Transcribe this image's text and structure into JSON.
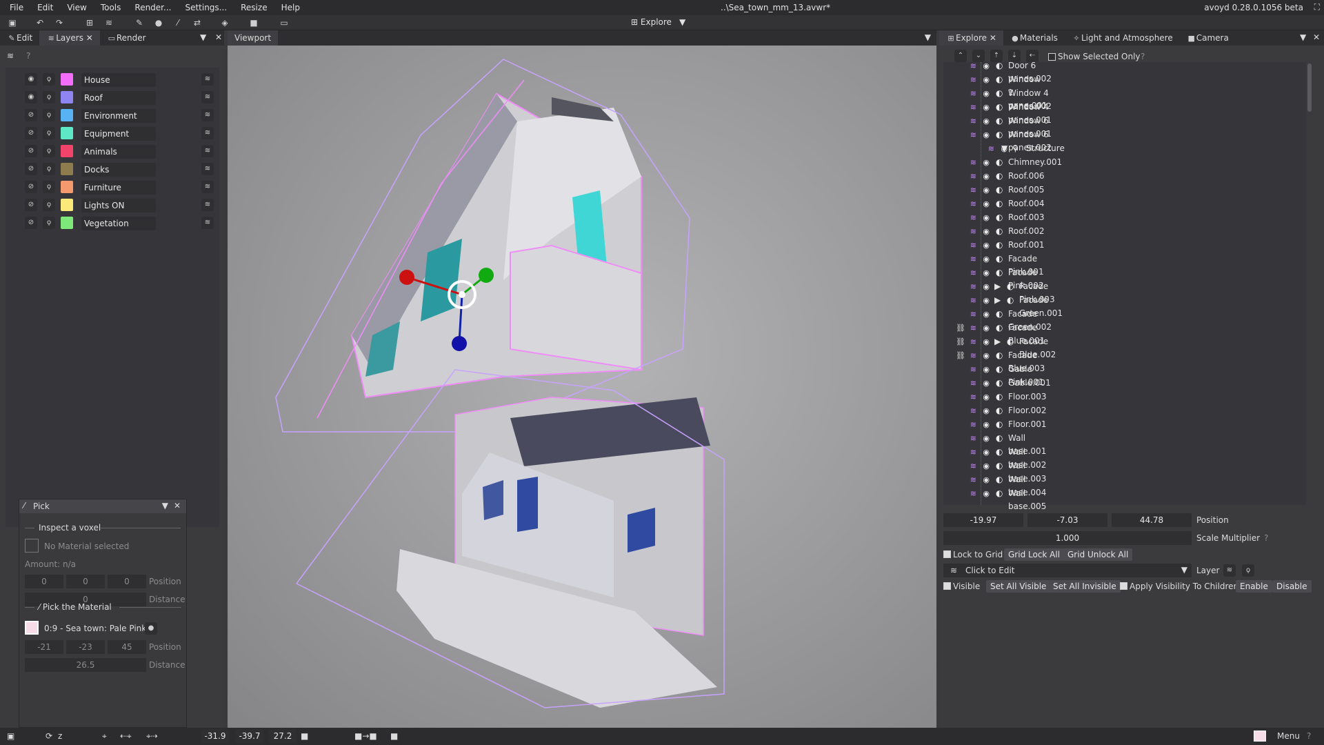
{
  "menu": [
    "File",
    "Edit",
    "View",
    "Tools",
    "Render...",
    "Settings...",
    "Resize",
    "Help"
  ],
  "window_title": "..\\Sea_town_mm_13.avwr*",
  "version": "avoyd 0.28.0.1056 beta",
  "toolbar": {
    "mode_label": "Explore"
  },
  "left_tabs": {
    "edit": "Edit",
    "layers": "Layers",
    "render": "Render"
  },
  "viewport_tab": "Viewport",
  "layers": [
    {
      "name": "House",
      "color": "#f26df9",
      "visible": true
    },
    {
      "name": "Roof",
      "color": "#8e84f2",
      "visible": true
    },
    {
      "name": "Environment",
      "color": "#58b3f5",
      "visible": false
    },
    {
      "name": "Equipment",
      "color": "#5ee8c5",
      "visible": false
    },
    {
      "name": "Animals",
      "color": "#f2436b",
      "visible": false
    },
    {
      "name": "Docks",
      "color": "#8e7c4e",
      "visible": false
    },
    {
      "name": "Furniture",
      "color": "#f59a6e",
      "visible": false
    },
    {
      "name": "Lights ON",
      "color": "#fbe97a",
      "visible": false
    },
    {
      "name": "Vegetation",
      "color": "#7ee87a",
      "visible": false
    }
  ],
  "pick": {
    "title": "Pick",
    "inspect_heading": "Inspect a voxel",
    "no_material": "No Material selected",
    "amount": "Amount: n/a",
    "inspect_pos": [
      "0",
      "0",
      "0"
    ],
    "position_label": "Position",
    "inspect_distance": "0",
    "distance_label": "Distance",
    "pick_material_heading": "Pick the Material",
    "material_name": "0:9 - Sea town: Pale Pink",
    "picked_pos": [
      "-21",
      "-23",
      "45"
    ],
    "picked_distance": "26.5"
  },
  "right_tabs": {
    "explore": "Explore",
    "materials": "Materials",
    "light": "Light and Atmosphere",
    "camera": "Camera"
  },
  "explore": {
    "show_selected_only": "Show Selected Only",
    "rows": [
      {
        "label": "Door 6 panes.002",
        "indent": 0,
        "hl": false,
        "link": false,
        "expander": ""
      },
      {
        "label": "Window 1 pane.001",
        "indent": 0,
        "hl": true,
        "link": false,
        "expander": ""
      },
      {
        "label": "Window 4 panes.002",
        "indent": 0,
        "hl": true,
        "link": false,
        "expander": ""
      },
      {
        "label": "Window 4 panes.001",
        "indent": 0,
        "hl": false,
        "link": false,
        "expander": ""
      },
      {
        "label": "Window 6 panes.001",
        "indent": 0,
        "hl": false,
        "link": false,
        "expander": ""
      },
      {
        "label": "Window 6 panes.002",
        "indent": 0,
        "hl": true,
        "link": false,
        "expander": ""
      },
      {
        "label": "Structure",
        "indent": -1,
        "hl": false,
        "link": false,
        "expander": "▼"
      },
      {
        "label": "Chimney.001",
        "indent": 0,
        "hl": false,
        "link": false,
        "expander": ""
      },
      {
        "label": "Roof.006",
        "indent": 0,
        "hl": true,
        "link": false,
        "expander": ""
      },
      {
        "label": "Roof.005",
        "indent": 0,
        "hl": true,
        "link": false,
        "expander": ""
      },
      {
        "label": "Roof.004",
        "indent": 0,
        "hl": true,
        "link": false,
        "expander": ""
      },
      {
        "label": "Roof.003",
        "indent": 0,
        "hl": false,
        "link": false,
        "expander": ""
      },
      {
        "label": "Roof.002",
        "indent": 0,
        "hl": false,
        "link": false,
        "expander": ""
      },
      {
        "label": "Roof.001",
        "indent": 0,
        "hl": false,
        "link": false,
        "expander": ""
      },
      {
        "label": "Facade Pink.001",
        "indent": 0,
        "hl": false,
        "link": false,
        "expander": ""
      },
      {
        "label": "Facade Pink.002",
        "indent": 0,
        "hl": true,
        "link": false,
        "expander": ""
      },
      {
        "label": "Facade Pink.003",
        "indent": 1,
        "hl": true,
        "link": false,
        "expander": "▶"
      },
      {
        "label": "Facade Green.001",
        "indent": 1,
        "hl": false,
        "link": false,
        "expander": "▶"
      },
      {
        "label": "Facade Green.002",
        "indent": 0,
        "hl": true,
        "link": false,
        "expander": ""
      },
      {
        "label": "Facade Blue.001",
        "indent": 0,
        "hl": false,
        "link": true,
        "expander": ""
      },
      {
        "label": "Facade Blue.002",
        "indent": 1,
        "hl": true,
        "link": true,
        "expander": "▶"
      },
      {
        "label": "Facade Blue.003",
        "indent": 0,
        "hl": false,
        "link": true,
        "expander": ""
      },
      {
        "label": "Gable Pink.001",
        "indent": 0,
        "hl": true,
        "link": false,
        "expander": ""
      },
      {
        "label": "Gable.001",
        "indent": 0,
        "hl": false,
        "link": false,
        "expander": ""
      },
      {
        "label": "Floor.003",
        "indent": 0,
        "hl": false,
        "link": false,
        "expander": ""
      },
      {
        "label": "Floor.002",
        "indent": 0,
        "hl": false,
        "link": false,
        "expander": ""
      },
      {
        "label": "Floor.001",
        "indent": 0,
        "hl": false,
        "link": false,
        "expander": ""
      },
      {
        "label": "Wall base.001",
        "indent": 0,
        "hl": false,
        "link": false,
        "expander": ""
      },
      {
        "label": "Wall base.002",
        "indent": 0,
        "hl": false,
        "link": false,
        "expander": ""
      },
      {
        "label": "Wall base.003",
        "indent": 0,
        "hl": false,
        "link": false,
        "expander": ""
      },
      {
        "label": "Wall base.004",
        "indent": 0,
        "hl": true,
        "link": false,
        "expander": ""
      },
      {
        "label": "Wall base.005",
        "indent": 0,
        "hl": true,
        "link": false,
        "expander": ""
      }
    ]
  },
  "props": {
    "position": [
      "-19.97",
      "-7.03",
      "44.78"
    ],
    "position_label": "Position",
    "scale": "1.000",
    "scale_label": "Scale Multiplier",
    "lock_to_grid": "Lock to Grid",
    "grid_lock_all": "Grid Lock All",
    "grid_unlock_all": "Grid Unlock All",
    "click_to_edit": "Click to Edit",
    "layer_label": "Layer",
    "visible": "Visible",
    "set_all_visible": "Set All Visible",
    "set_all_invisible": "Set All Invisible",
    "apply_visibility": "Apply Visibility To Children",
    "enable": "Enable",
    "disable": "Disable"
  },
  "status": {
    "z_label": "z",
    "coords": [
      "-31.9",
      "-39.7",
      "27.2"
    ],
    "menu": "Menu"
  }
}
